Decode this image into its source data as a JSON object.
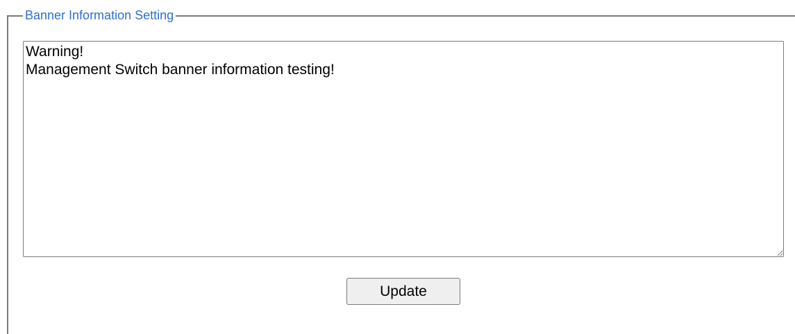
{
  "section": {
    "legend": "Banner Information Setting"
  },
  "banner": {
    "text": "Warning!\nManagement Switch banner information testing!"
  },
  "actions": {
    "update_label": "Update"
  },
  "colors": {
    "legend_text": "#2f6fd0",
    "frame_border": "#7a7a7a",
    "button_bg": "#efefef"
  }
}
